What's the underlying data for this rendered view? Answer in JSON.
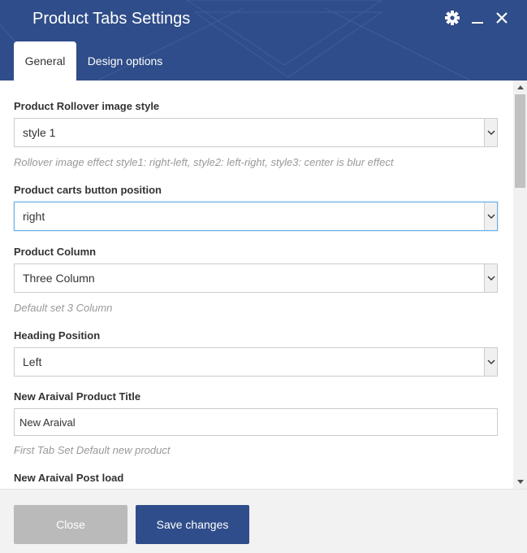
{
  "dialog": {
    "title": "Product Tabs Settings",
    "icons": [
      "gear-icon",
      "minimize-icon",
      "close-icon"
    ]
  },
  "tabs": [
    {
      "label": "General",
      "active": true
    },
    {
      "label": "Design options",
      "active": false
    }
  ],
  "fields": {
    "rollover_style": {
      "label": "Product Rollover image style",
      "value": "style 1",
      "help": "Rollover image effect style1: right-left, style2: left-right, style3: center is blur effect"
    },
    "cart_button_position": {
      "label": "Product carts button position",
      "value": "right"
    },
    "product_column": {
      "label": "Product Column",
      "value": "Three Column",
      "help": "Default set 3 Column"
    },
    "heading_position": {
      "label": "Heading Position",
      "value": "Left"
    },
    "new_arrival_title": {
      "label": "New Araival Product Title",
      "value": "New Araival",
      "help": "First Tab Set Default new product"
    },
    "new_arrival_post_load": {
      "label": "New Araival Post load"
    }
  },
  "footer": {
    "close_label": "Close",
    "save_label": "Save changes"
  },
  "colors": {
    "header": "#2f4d8a",
    "save_button": "#2f4d8a",
    "close_button": "#bababa",
    "focus_border": "#66afe9"
  }
}
